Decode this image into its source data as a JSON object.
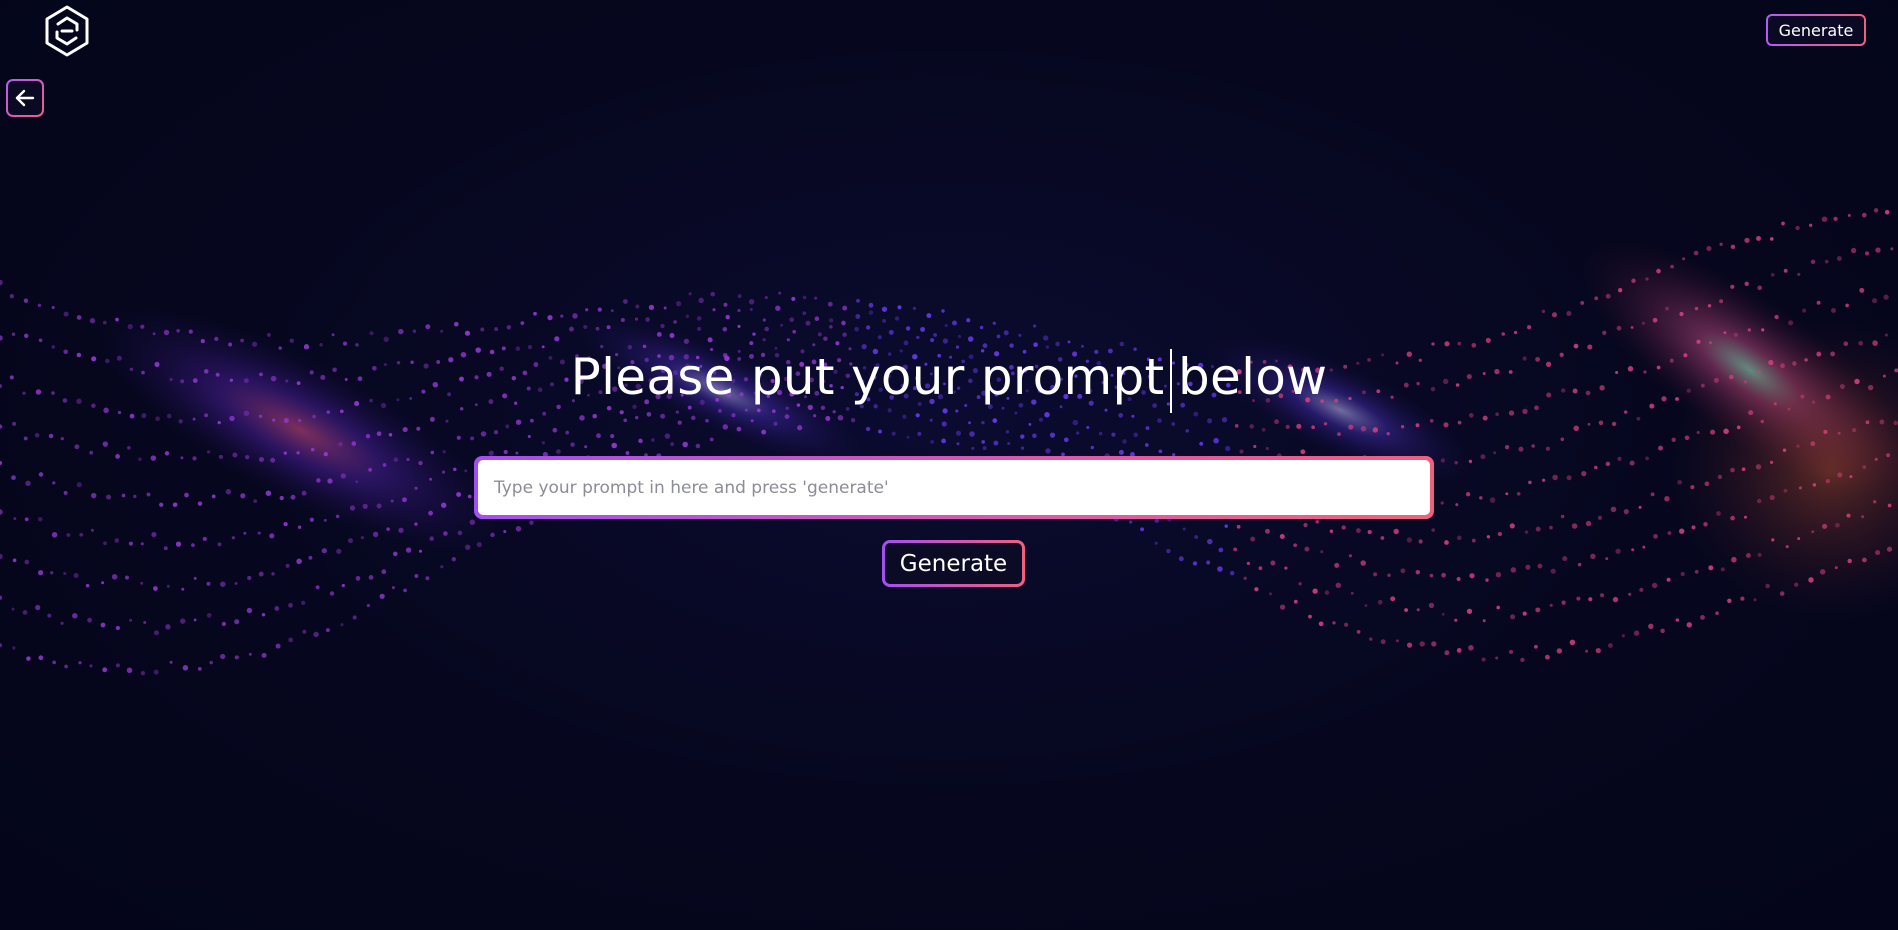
{
  "header": {
    "logo_icon": "hexagon-logo-icon",
    "generate_label": "Generate"
  },
  "nav": {
    "back_icon": "arrow-left-icon"
  },
  "main": {
    "headline_part1": "Please put your prompt",
    "headline_part2": "below",
    "prompt": {
      "value": "",
      "placeholder": "Type your prompt in here and press 'generate'"
    },
    "generate_label": "Generate"
  },
  "colors": {
    "background": "#05061a",
    "accent_purple": "#a44ff0",
    "accent_pink": "#f0607e",
    "text": "#ffffff"
  }
}
